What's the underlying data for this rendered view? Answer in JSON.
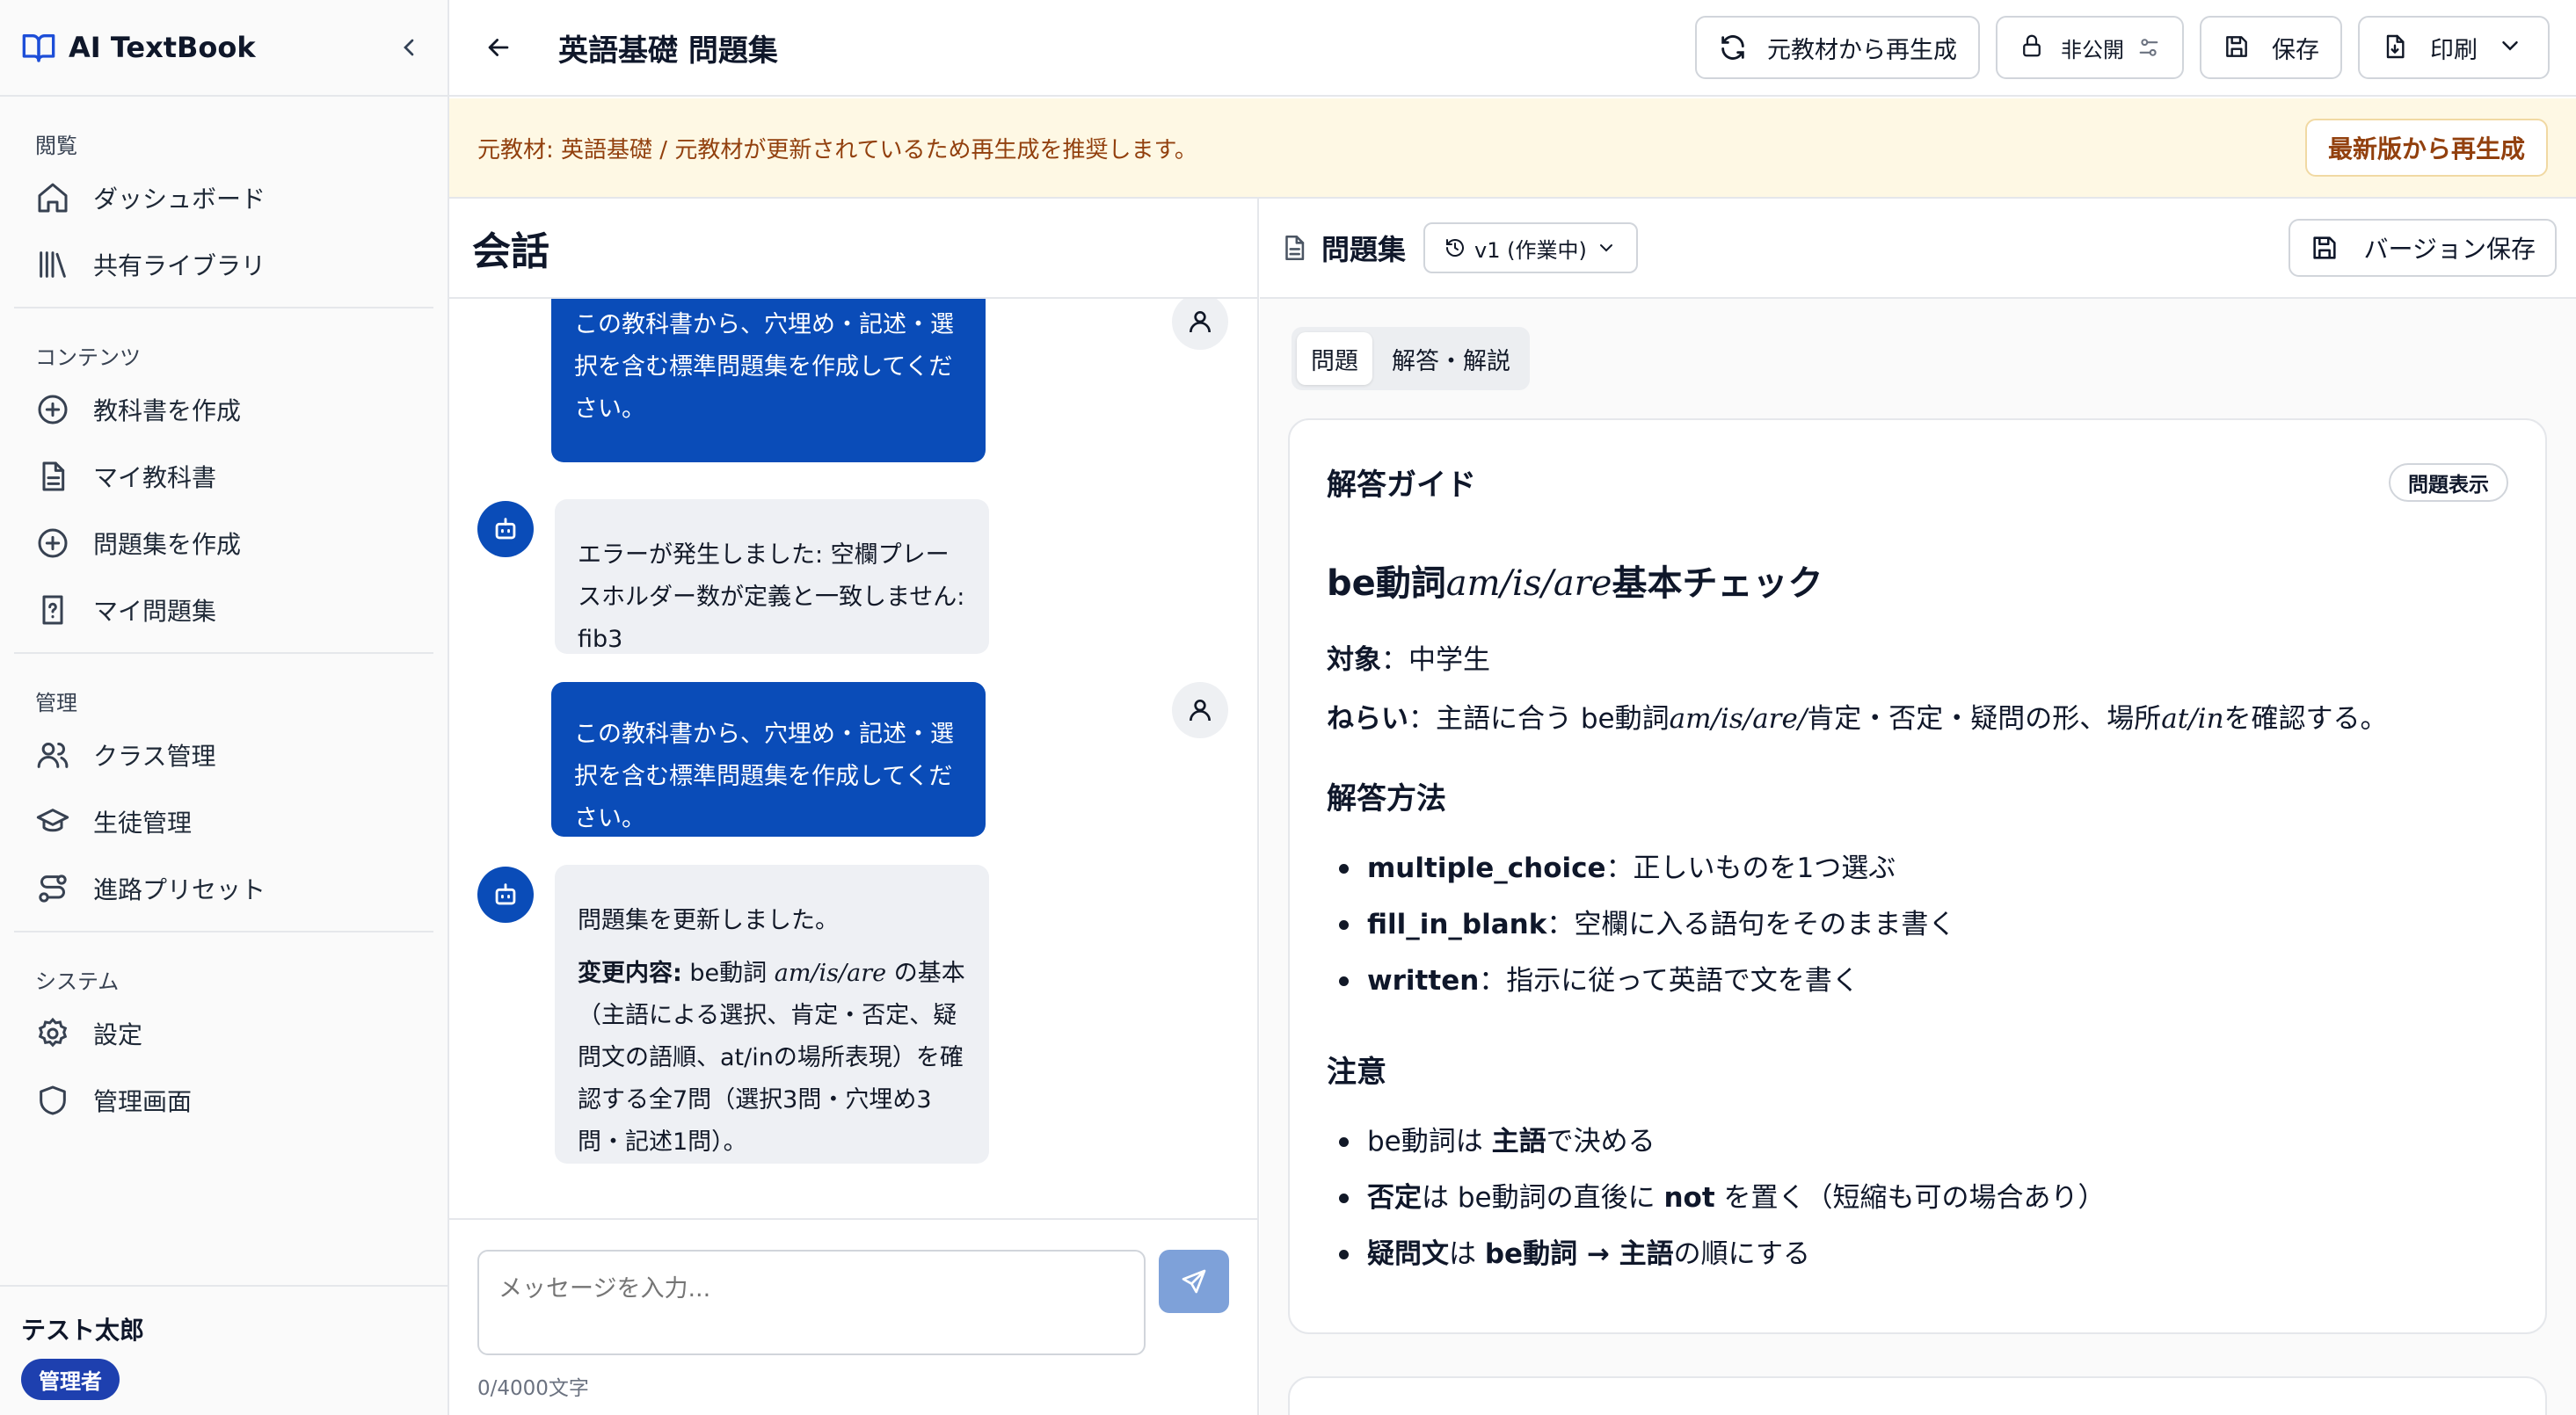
{
  "app": {
    "title": "AI TextBook"
  },
  "sidebar": {
    "sections": [
      {
        "title": "閲覧",
        "items": [
          {
            "label": "ダッシュボード"
          },
          {
            "label": "共有ライブラリ"
          }
        ]
      },
      {
        "title": "コンテンツ",
        "items": [
          {
            "label": "教科書を作成"
          },
          {
            "label": "マイ教科書"
          },
          {
            "label": "問題集を作成"
          },
          {
            "label": "マイ問題集"
          }
        ]
      },
      {
        "title": "管理",
        "items": [
          {
            "label": "クラス管理"
          },
          {
            "label": "生徒管理"
          },
          {
            "label": "進路プリセット"
          }
        ]
      },
      {
        "title": "システム",
        "items": [
          {
            "label": "設定"
          },
          {
            "label": "管理画面"
          }
        ]
      }
    ],
    "user": {
      "name": "テスト太郎",
      "role": "管理者"
    }
  },
  "header": {
    "title": "英語基礎 問題集",
    "regenerate_label": "元教材から再生成",
    "visibility_label": "非公開",
    "save_label": "保存",
    "print_label": "印刷"
  },
  "banner": {
    "text": "元教材: 英語基礎 / 元教材が更新されているため再生成を推奨します。",
    "button_label": "最新版から再生成"
  },
  "chat": {
    "title": "会話",
    "messages": [
      {
        "role": "user",
        "text": "この教科書から、穴埋め・記述・選択を含む標準問題集を作成してください。"
      },
      {
        "role": "assistant",
        "text": "エラーが発生しました: 空欄プレースホルダー数が定義と一致しません: fib3"
      },
      {
        "role": "user",
        "text": "この教科書から、穴埋め・記述・選択を含む標準問題集を作成してください。"
      },
      {
        "role": "assistant",
        "line1": "問題集を更新しました。",
        "changes_label": "変更内容:",
        "changes_pre": " be動詞 ",
        "changes_math": "am/is/are",
        "changes_post": " の基本（主語による選択、肯定・否定、疑問文の語順、at/inの場所表現）を確認する全7問（選択3問・穴埋め3問・記述1問）。"
      }
    ],
    "input_placeholder": "メッセージを入力...",
    "char_count": "0/4000文字"
  },
  "problem_set": {
    "title": "問題集",
    "version_label": "v1 (作業中)",
    "save_version_label": "バージョン保存",
    "tabs": [
      {
        "label": "問題"
      },
      {
        "label": "解答・解説"
      }
    ],
    "active_tab": 0,
    "guide": {
      "heading": "解答ガイド",
      "toggle_label": "問題表示",
      "set_title_pre": "be動詞",
      "set_title_math": "am/is/are",
      "set_title_post": "基本チェック",
      "target_label": "対象",
      "target_sep": "：",
      "target_value": "中学生",
      "aim_label": "ねらい",
      "aim_sep": "：",
      "aim_pre": "主語に合う be動詞",
      "aim_math1": "am/is/are/",
      "aim_mid": "肯定・否定・疑問の形、場所",
      "aim_math2": "at/in",
      "aim_post": "を確認する。",
      "methods_heading": "解答方法",
      "methods": [
        {
          "term": "multiple_choice",
          "desc": "：正しいものを1つ選ぶ"
        },
        {
          "term": "fill_in_blank",
          "desc": "：空欄に入る語句をそのまま書く"
        },
        {
          "term": "written",
          "desc": "：指示に従って英語で文を書く"
        }
      ],
      "notes_heading": "注意",
      "notes": [
        {
          "a": "be動詞は ",
          "b": "主語",
          "c": "で決める",
          "d": "",
          "e": ""
        },
        {
          "a": "",
          "b": "否定",
          "c": "は be動詞の直後に ",
          "d": "not",
          "e": " を置く（短縮も可の場合あり）"
        },
        {
          "a": "",
          "b": "疑問文",
          "c": "は ",
          "d": "be動詞 → 主語",
          "e": "の順にする"
        }
      ]
    }
  }
}
